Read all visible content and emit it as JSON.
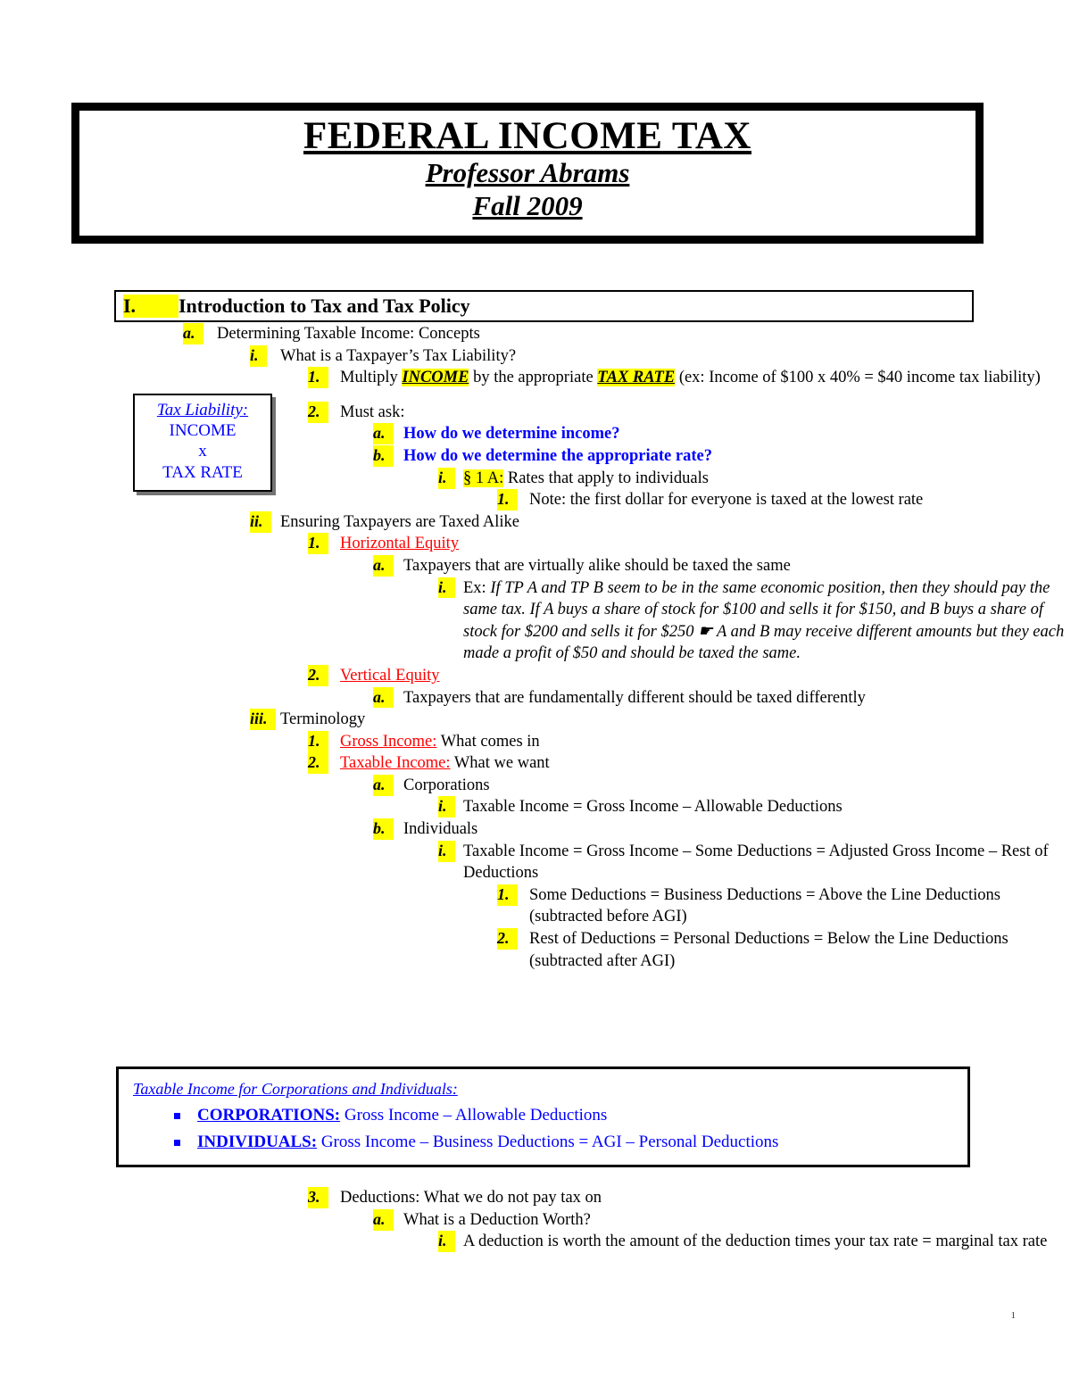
{
  "document": {
    "title": "FEDERAL INCOME TAX",
    "professor": "Professor Abrams",
    "term": "Fall 2009",
    "page_number": "1"
  },
  "section": {
    "numeral": "I.",
    "heading": "Introduction to Tax and Tax Policy"
  },
  "callout_tax_liability": {
    "heading": "Tax Liability:",
    "line1": "INCOME",
    "line2": "x",
    "line3": "TAX RATE"
  },
  "outline": {
    "a_label": "a.",
    "a_text": "Determining Taxable Income: Concepts",
    "i1_label": "i.",
    "i1_text": "What is a Taxpayer’s Tax Liability?",
    "i1_1_label": "1.",
    "i1_1_pre": "Multiply ",
    "i1_1_key1": "INCOME",
    "i1_1_mid": " by the appropriate ",
    "i1_1_key2": "TAX RATE",
    "i1_1_post": " (ex: Income of $100 x 40% = $40 income tax liability)",
    "i1_2_label": "2.",
    "i1_2_text": "Must ask:",
    "i1_2_a_label": "a.",
    "i1_2_a_text": "How do we determine income?",
    "i1_2_b_label": "b.",
    "i1_2_b_text": "How do we determine the appropriate rate?",
    "i1_2_b_i_label": "i.",
    "i1_2_b_i_cite": "§ 1 A:",
    "i1_2_b_i_text": " Rates that apply to individuals",
    "i1_2_b_i_1_label": "1.",
    "i1_2_b_i_1_text": "Note: the first dollar for everyone is taxed at the lowest rate",
    "i2_label": "ii.",
    "i2_text": "Ensuring Taxpayers are Taxed Alike",
    "i2_1_label": "1.",
    "i2_1_term": "Horizontal Equity",
    "i2_1_a_label": "a.",
    "i2_1_a_text": "Taxpayers that are virtually alike should be taxed the same",
    "i2_1_a_i_label": "i.",
    "i2_1_a_i_pre": "Ex: ",
    "i2_1_a_i_text": "If TP A and TP B seem to be in the same economic position, then they should pay the same tax.  If A buys a share of stock for $100 and sells it for $150, and B buys a share of stock for $200 and sells it for $250 ☛  A and B may receive different amounts but they each made a profit of $50 and should be taxed the same.",
    "i2_2_label": "2.",
    "i2_2_term": "Vertical Equity",
    "i2_2_a_label": "a.",
    "i2_2_a_text": "Taxpayers that are fundamentally different should be taxed differently",
    "i3_label": "iii.",
    "i3_text": "Terminology",
    "i3_1_label": "1.",
    "i3_1_term": "Gross Income:",
    "i3_1_text": " What comes in",
    "i3_2_label": "2.",
    "i3_2_term": "Taxable Income:",
    "i3_2_text": " What we want",
    "i3_2_a_label": "a.",
    "i3_2_a_text": "Corporations",
    "i3_2_a_i_label": "i.",
    "i3_2_a_i_text": "Taxable Income = Gross Income – Allowable Deductions",
    "i3_2_b_label": "b.",
    "i3_2_b_text": "Individuals",
    "i3_2_b_i_label": "i.",
    "i3_2_b_i_text": "Taxable Income = Gross Income – Some Deductions = Adjusted Gross Income – Rest of Deductions",
    "i3_2_b_i_1_label": "1.",
    "i3_2_b_i_1_text": "Some Deductions = Business Deductions = Above the Line Deductions (subtracted before AGI)",
    "i3_2_b_i_2_label": "2.",
    "i3_2_b_i_2_text": "Rest of Deductions = Personal Deductions = Below the Line Deductions (subtracted after AGI)",
    "i3_3_label": "3.",
    "i3_3_text": "Deductions: What we do not pay tax on",
    "i3_3_a_label": "a.",
    "i3_3_a_text": "What is a Deduction Worth?",
    "i3_3_a_i_label": "i.",
    "i3_3_a_i_text": "A deduction is worth the amount of the deduction times your tax rate = marginal tax rate"
  },
  "callout_summary": {
    "heading": "Taxable Income for Corporations and Individuals:",
    "items": [
      {
        "label": "CORPORATIONS:",
        "text": " Gross Income – Allowable Deductions"
      },
      {
        "label": "INDIVIDUALS:",
        "text": " Gross Income – Business Deductions = AGI – Personal Deductions"
      }
    ]
  }
}
